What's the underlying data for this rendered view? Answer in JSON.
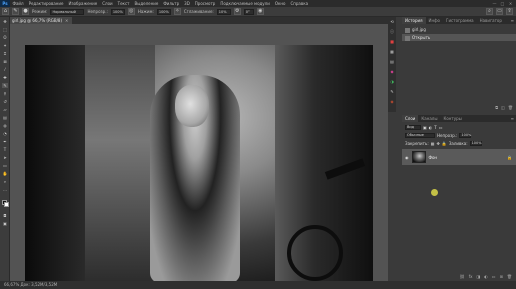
{
  "menubar": {
    "logo": "Ps",
    "items": [
      "Файл",
      "Редактирование",
      "Изображение",
      "Слои",
      "Текст",
      "Выделение",
      "Фильтр",
      "3D",
      "Просмотр",
      "Подключаемые модули",
      "Окно",
      "Справка"
    ],
    "window_controls": [
      "—",
      "□",
      "✕"
    ]
  },
  "options": {
    "mode_label": "Режим:",
    "mode_value": "Нормальный",
    "opacity_label": "Непрозр.:",
    "opacity_value": "100%",
    "flow_label": "Нажим:",
    "flow_value": "100%",
    "smoothing_label": "Сглаживание:",
    "smoothing_value": "10%",
    "angle_value": "0°"
  },
  "document": {
    "tab_title": "girl.jpg @ 66,7% (RGB/8)",
    "close": "✕"
  },
  "status": {
    "text": "66,67%   Док: 3,52M/3,52M"
  },
  "history": {
    "tabs": [
      "История",
      "Инфо",
      "Гистограмма",
      "Навигатор"
    ],
    "snapshot": "girl.jpg",
    "state": "Открыть"
  },
  "layers": {
    "tabs": [
      "Слои",
      "Каналы",
      "Контуры"
    ],
    "filter_label": "Вид",
    "blend_value": "Обычные",
    "opacity_label": "Непрозр.:",
    "opacity_value": "100%",
    "lock_label": "Закрепить:",
    "fill_label": "Заливка:",
    "fill_value": "100%",
    "items": [
      {
        "name": "Фон"
      }
    ]
  },
  "colors": {
    "accent": "#4aa3ff",
    "panel_bg": "#3a3a3a",
    "canvas_bg": "#535353",
    "cursor_highlight": "#e6e24a"
  }
}
